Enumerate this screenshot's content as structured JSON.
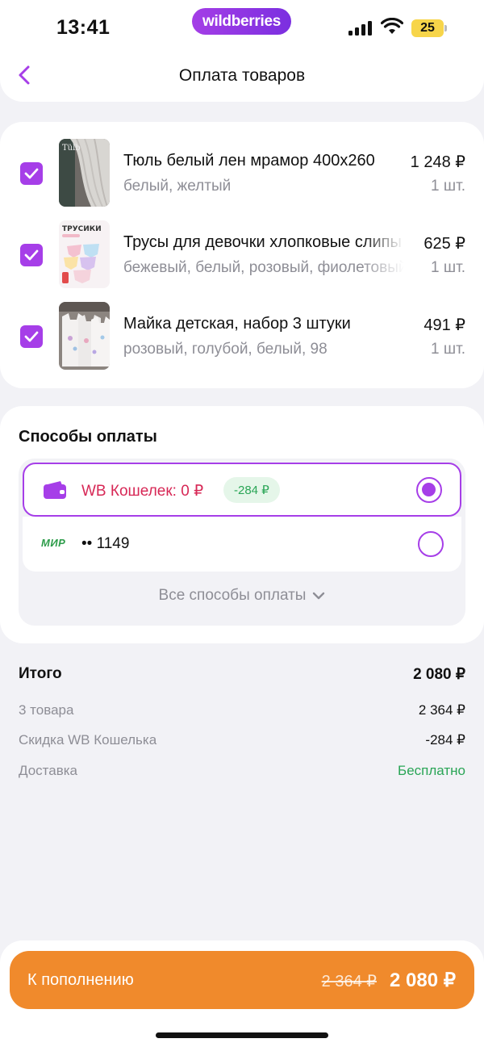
{
  "status_bar": {
    "time": "13:41",
    "brand": "wildberries",
    "battery": "25"
  },
  "header": {
    "title": "Оплата товаров",
    "back_icon": "chevron-left-icon"
  },
  "products": [
    {
      "name": "Тюль белый лен мрамор 400х260",
      "variant": "белый, желтый",
      "price": "1 248 ₽",
      "qty": "1 шт.",
      "checked": true,
      "thumb_label": "Tülb"
    },
    {
      "name": "Трусы для девочки хлопковые слипы",
      "variant": "бежевый, белый, розовый, фиолетовый",
      "price": "625 ₽",
      "qty": "1 шт.",
      "checked": true,
      "thumb_label": "ТРУСИКИ"
    },
    {
      "name": "Майка детская, набор 3 штуки",
      "variant": "розовый, голубой, белый, 98",
      "price": "491 ₽",
      "qty": "1 шт.",
      "checked": true,
      "thumb_label": ""
    }
  ],
  "payment": {
    "title": "Способы оплаты",
    "wallet": {
      "label": "WB Кошелек: 0 ₽",
      "discount": "-284 ₽",
      "selected": true
    },
    "card": {
      "brand": "МИР",
      "number": "•• 1149",
      "selected": false
    },
    "all_methods": "Все способы оплаты"
  },
  "totals": {
    "total_label": "Итого",
    "total_value": "2 080 ₽",
    "items_label": "3 товара",
    "items_value": "2 364 ₽",
    "discount_label": "Скидка WB Кошелька",
    "discount_value": "-284 ₽",
    "delivery_label": "Доставка",
    "delivery_value": "Бесплатно"
  },
  "pay_button": {
    "label": "К пополнению",
    "old_price": "2 364 ₽",
    "new_price": "2 080 ₽"
  },
  "colors": {
    "accent": "#a63ee8",
    "button": "#f08a2c",
    "green": "#2aa556",
    "wallet_red": "#d72856"
  }
}
